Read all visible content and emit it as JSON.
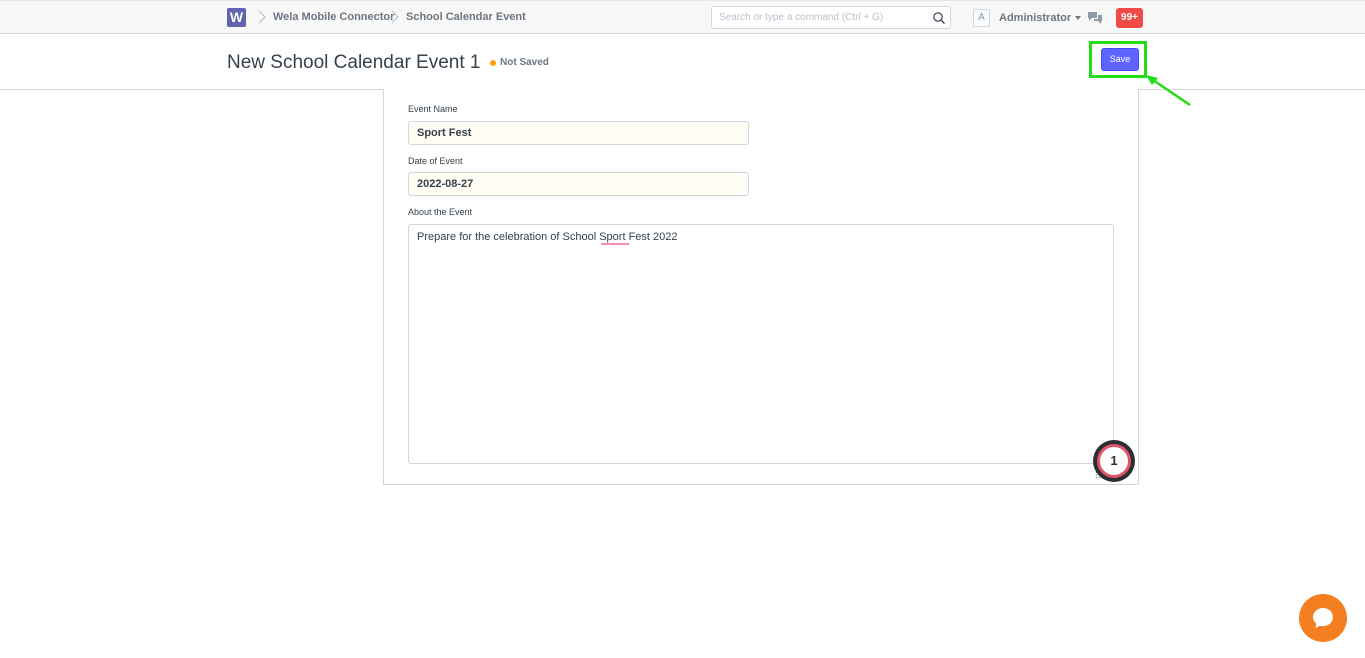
{
  "navbar": {
    "logo_letter": "W",
    "breadcrumbs": [
      "Wela Mobile Connector",
      "School Calendar Event"
    ],
    "search_placeholder": "Search or type a command (Ctrl + G)",
    "avatar_letter": "A",
    "user_name": "Administrator",
    "notification_count": "99+"
  },
  "page": {
    "title": "New School Calendar Event 1",
    "status": "Not Saved",
    "save_label": "Save"
  },
  "form": {
    "event_name_label": "Event Name",
    "event_name_value": "Sport Fest",
    "date_label": "Date of Event",
    "date_value": "2022-08-27",
    "about_label": "About the Event",
    "about_value": "Prepare for the celebration of School Sport Fest 2022"
  },
  "annotation": {
    "step_number": "1"
  },
  "colors": {
    "primary": "#5e64ff",
    "highlight": "#22dd11",
    "status_dot": "#ffa00a",
    "badge": "#ef4a47",
    "chat_launcher": "#f37f21"
  }
}
